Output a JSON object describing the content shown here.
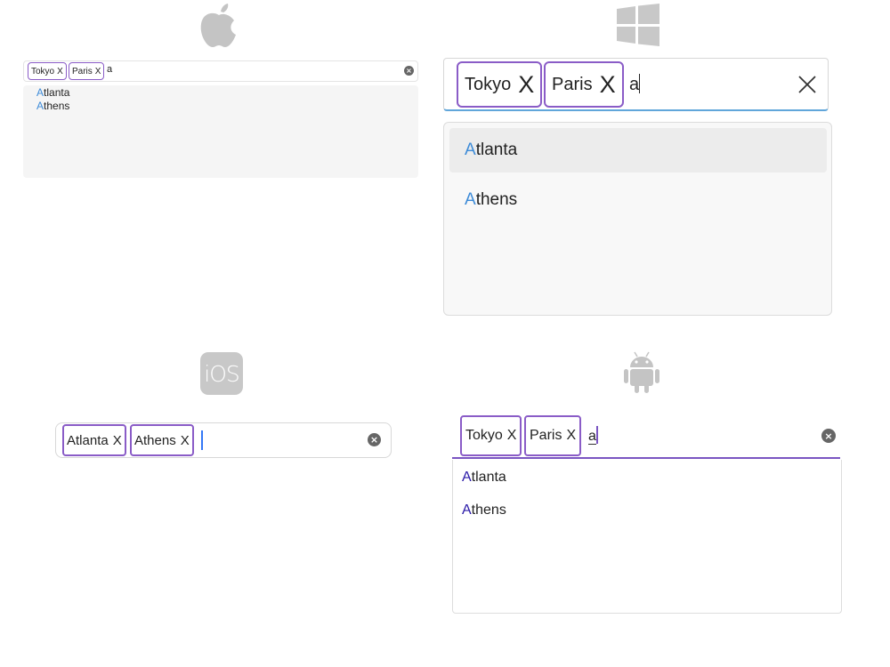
{
  "platforms": {
    "macos": {
      "icon": "apple-logo-icon",
      "chips": [
        {
          "label": "Tokyo",
          "close": "X"
        },
        {
          "label": "Paris",
          "close": "X"
        }
      ],
      "input_value": "a",
      "clear_icon": "x-circle-icon",
      "suggestions": [
        {
          "match": "A",
          "rest": "tlanta"
        },
        {
          "match": "A",
          "rest": "thens"
        }
      ]
    },
    "windows": {
      "icon": "windows-logo-icon",
      "chips": [
        {
          "label": "Tokyo",
          "close": "X"
        },
        {
          "label": "Paris",
          "close": "X"
        }
      ],
      "input_value": "a",
      "clear_icon": "close-icon",
      "suggestions": [
        {
          "match": "A",
          "rest": "tlanta"
        },
        {
          "match": "A",
          "rest": "thens"
        }
      ]
    },
    "ios": {
      "icon": "ios-logo-icon",
      "logo_text": "iOS",
      "chips": [
        {
          "label": "Atlanta",
          "close": "X"
        },
        {
          "label": "Athens",
          "close": "X"
        }
      ],
      "input_value": "",
      "clear_icon": "x-circle-icon"
    },
    "android": {
      "icon": "android-logo-icon",
      "chips": [
        {
          "label": "Tokyo",
          "close": "X"
        },
        {
          "label": "Paris",
          "close": "X"
        }
      ],
      "input_value": "a",
      "clear_icon": "x-circle-icon",
      "suggestions": [
        {
          "match": "A",
          "rest": "tlanta"
        },
        {
          "match": "A",
          "rest": "thens"
        }
      ]
    }
  },
  "colors": {
    "chip_border": "#8a5cc7",
    "windows_highlight": "#3d8bd8",
    "windows_focus_line": "#61a6da",
    "android_highlight": "#2a1aa8",
    "android_underline": "#7a55c2",
    "ios_caret": "#3478f6"
  }
}
